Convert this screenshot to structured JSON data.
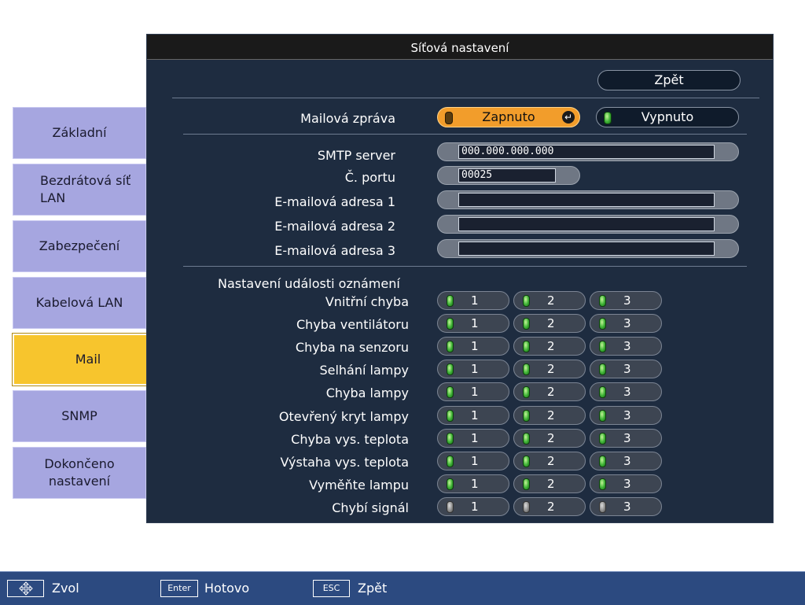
{
  "window": {
    "title": "Síťová nastavení"
  },
  "tabs": [
    {
      "label_lines": [
        "Základní"
      ],
      "active": false
    },
    {
      "label_lines": [
        "Bezdrátová síť",
        "LAN"
      ],
      "active": false
    },
    {
      "label_lines": [
        "Zabezpečení"
      ],
      "active": false
    },
    {
      "label_lines": [
        "Kabelová LAN"
      ],
      "active": false
    },
    {
      "label_lines": [
        "Mail"
      ],
      "active": true
    },
    {
      "label_lines": [
        "SNMP"
      ],
      "active": false
    },
    {
      "label_lines": [
        "Dokončeno",
        "nastavení"
      ],
      "active": false
    }
  ],
  "back_button": {
    "label": "Zpět"
  },
  "mail_message": {
    "label": "Mailová zpráva",
    "options": [
      {
        "label": "Zapnuto",
        "selected": true
      },
      {
        "label": "Vypnuto",
        "selected": false
      }
    ],
    "enter_icon": "enter-icon"
  },
  "fields": {
    "smtp": {
      "label": "SMTP server",
      "value": "000.000.000.000"
    },
    "port": {
      "label": "Č. portu",
      "value": "00025"
    },
    "email1": {
      "label": "E-mailová adresa 1",
      "value": ""
    },
    "email2": {
      "label": "E-mailová adresa 2",
      "value": ""
    },
    "email3": {
      "label": "E-mailová adresa 3",
      "value": ""
    }
  },
  "events": {
    "heading": "Nastavení události oznámení",
    "columns": [
      "1",
      "2",
      "3"
    ],
    "rows": [
      {
        "label": "Vnitřní chyba",
        "enabled": [
          true,
          true,
          true
        ]
      },
      {
        "label": "Chyba ventilátoru",
        "enabled": [
          true,
          true,
          true
        ]
      },
      {
        "label": "Chyba na senzoru",
        "enabled": [
          true,
          true,
          true
        ]
      },
      {
        "label": "Selhání lampy",
        "enabled": [
          true,
          true,
          true
        ]
      },
      {
        "label": "Chyba lampy",
        "enabled": [
          true,
          true,
          true
        ]
      },
      {
        "label": "Otevřený kryt lampy",
        "enabled": [
          true,
          true,
          true
        ]
      },
      {
        "label": "Chyba vys. teplota",
        "enabled": [
          true,
          true,
          true
        ]
      },
      {
        "label": "Výstaha vys. teplota",
        "enabled": [
          true,
          true,
          true
        ]
      },
      {
        "label": "Vyměňte lampu",
        "enabled": [
          true,
          true,
          true
        ]
      },
      {
        "label": "Chybí signál",
        "enabled": [
          false,
          false,
          false
        ]
      }
    ]
  },
  "bottom_bar": {
    "items": [
      {
        "icon": "move-arrows-icon",
        "key": "",
        "label": "Zvol"
      },
      {
        "icon": "enter-key-icon",
        "key": "Enter",
        "label": "Hotovo"
      },
      {
        "icon": "esc-key-icon",
        "key": "ESC",
        "label": "Zpět"
      }
    ]
  },
  "colors": {
    "active_tab": "#f7c52d",
    "tab": "#a6a6e0",
    "panel": "#1e2c40",
    "selected_option": "#f29d2b",
    "bottom_bar": "#2c4a80"
  }
}
